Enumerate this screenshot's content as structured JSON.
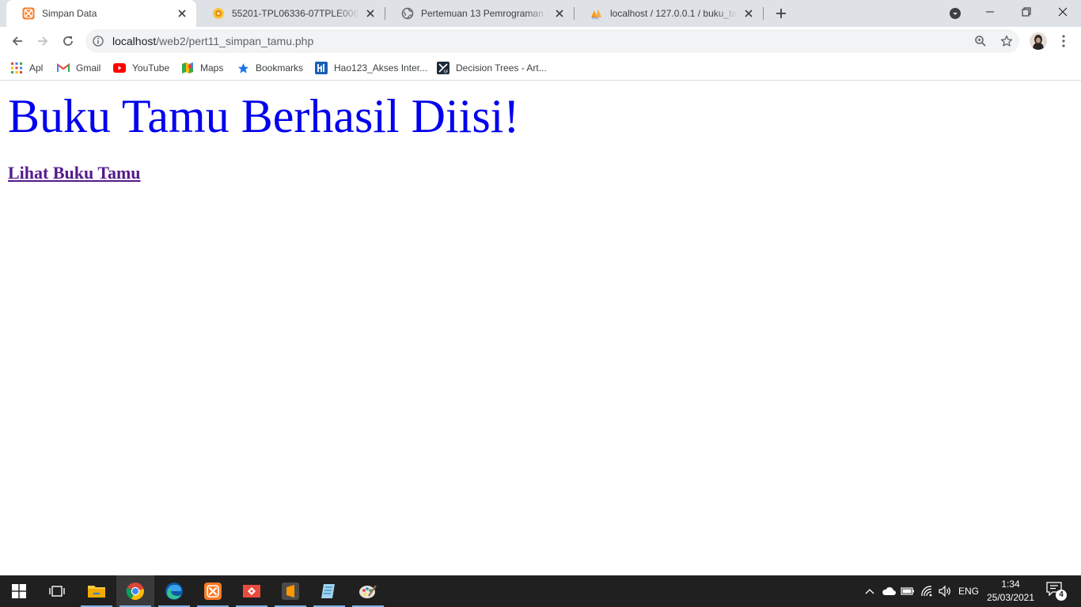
{
  "browser": {
    "tabs": [
      {
        "title": "Simpan Data",
        "icon": "xampp-icon",
        "active": true
      },
      {
        "title": "55201-TPL06336-07TPLE006-2020",
        "icon": "moodle-icon",
        "active": false
      },
      {
        "title": "Pertemuan 13 Pemrograman Web",
        "icon": "globe-icon",
        "active": false
      },
      {
        "title": "localhost / 127.0.0.1 / buku_tamu",
        "icon": "phpmyadmin-icon",
        "active": false
      }
    ],
    "address": {
      "host": "localhost",
      "path": "/web2/pert11_simpan_tamu.php"
    },
    "bookmarks": [
      {
        "label": "Apl",
        "icon": "apps-grid-icon"
      },
      {
        "label": "Gmail",
        "icon": "gmail-icon"
      },
      {
        "label": "YouTube",
        "icon": "youtube-icon"
      },
      {
        "label": "Maps",
        "icon": "maps-icon"
      },
      {
        "label": "Bookmarks",
        "icon": "star-icon"
      },
      {
        "label": "Hao123_Akses Inter...",
        "icon": "hao123-icon"
      },
      {
        "label": "Decision Trees - Art...",
        "icon": "sf-icon"
      }
    ]
  },
  "page": {
    "heading": "Buku Tamu Berhasil Diisi!",
    "link_text": "Lihat Buku Tamu"
  },
  "taskbar": {
    "apps": [
      {
        "name": "file-explorer",
        "icon": "folder-icon"
      },
      {
        "name": "chrome",
        "icon": "chrome-icon"
      },
      {
        "name": "edge",
        "icon": "edge-icon"
      },
      {
        "name": "xampp",
        "icon": "xampp-icon"
      },
      {
        "name": "git",
        "icon": "git-icon"
      },
      {
        "name": "sublime-text",
        "icon": "sublime-icon"
      },
      {
        "name": "notepad",
        "icon": "notepad-icon"
      },
      {
        "name": "paint",
        "icon": "paint-icon"
      }
    ],
    "language": "ENG",
    "time": "1:34",
    "date": "25/03/2021",
    "notification_count": "4"
  },
  "colors": {
    "heading": "#0000ee",
    "link_visited": "#551a8b",
    "tabstrip": "#dee1e6",
    "taskbar": "#202020"
  }
}
